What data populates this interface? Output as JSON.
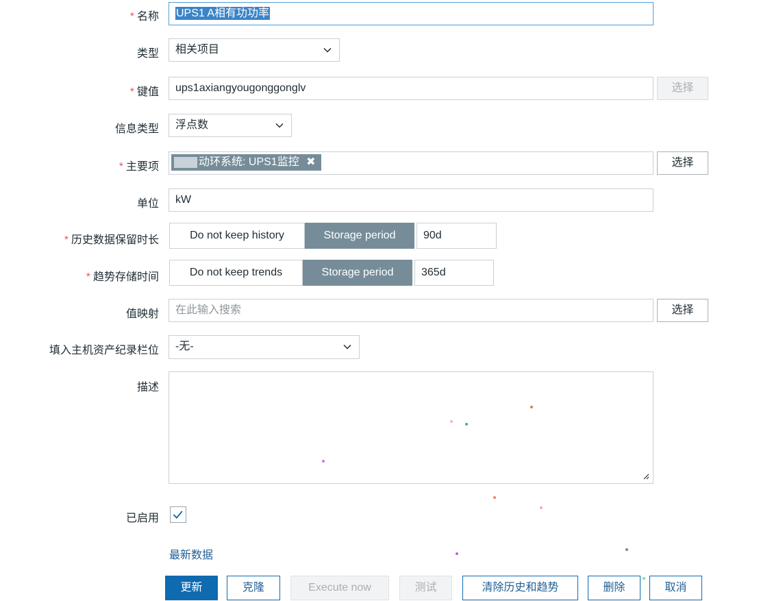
{
  "form": {
    "required_mark": "*",
    "name": {
      "label": "名称",
      "value": "UPS1 A相有功功率"
    },
    "type": {
      "label": "类型",
      "value": "相关项目"
    },
    "key": {
      "label": "键值",
      "value": "ups1axiangyougonggonglv",
      "select_label": "选择"
    },
    "info_type": {
      "label": "信息类型",
      "value": "浮点数"
    },
    "master_item": {
      "label": "主要项",
      "tag_text": "动环系统: UPS1监控",
      "select_label": "选择"
    },
    "units": {
      "label": "单位",
      "value": "kW"
    },
    "history": {
      "label": "历史数据保留时长",
      "opt_off": "Do not keep history",
      "opt_on": "Storage period",
      "value": "90d"
    },
    "trends": {
      "label": "趋势存储时间",
      "opt_off": "Do not keep trends",
      "opt_on": "Storage period",
      "value": "365d"
    },
    "valuemap": {
      "label": "值映射",
      "placeholder": "在此输入搜索",
      "select_label": "选择"
    },
    "inventory": {
      "label": "填入主机资产纪录栏位",
      "value": "-无-"
    },
    "description": {
      "label": "描述",
      "value": ""
    },
    "enabled": {
      "label": "已启用",
      "checked": true
    },
    "latest_link": "最新数据"
  },
  "actions": {
    "update": "更新",
    "clone": "克隆",
    "execute_now": "Execute now",
    "test": "测试",
    "clear": "清除历史和趋势",
    "delete": "删除",
    "cancel": "取消"
  },
  "colors": {
    "accent": "#0f6ab0",
    "toggle_active": "#768d99",
    "required": "#e45959"
  }
}
